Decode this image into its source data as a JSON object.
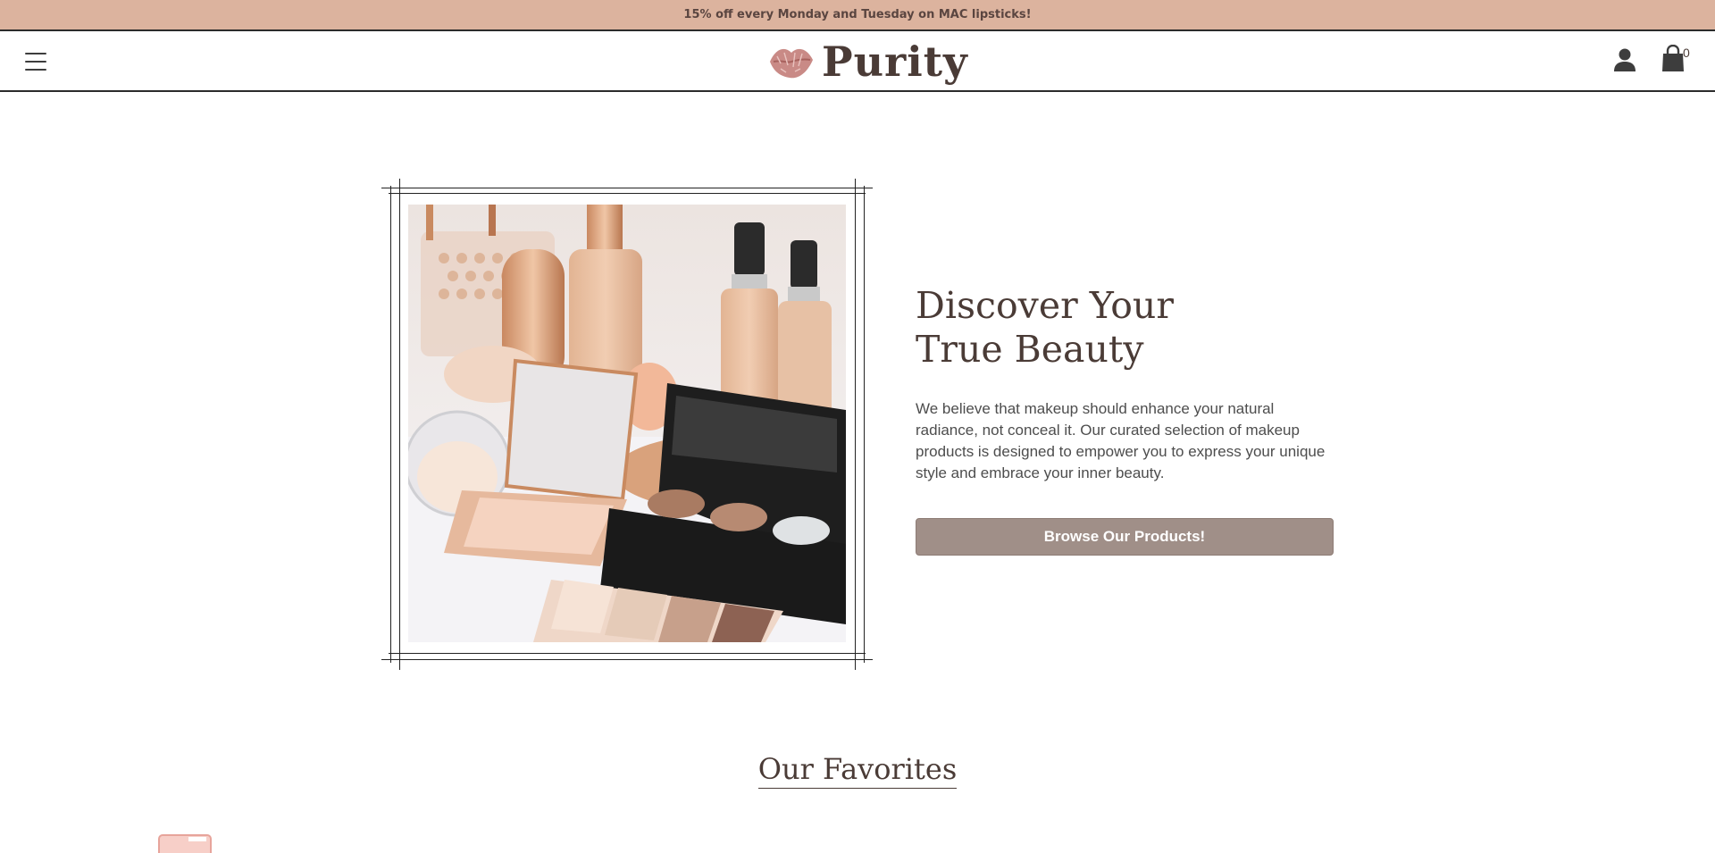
{
  "promo": {
    "text": "15% off every Monday and Tuesday on MAC lipsticks!"
  },
  "header": {
    "logo_text": "Purity",
    "cart_count": "0",
    "icons": {
      "menu": "hamburger-icon",
      "account": "user-icon",
      "cart": "shopping-bag-icon",
      "logo": "lips-icon"
    }
  },
  "hero": {
    "title": "Discover Your True Beauty",
    "description": "We believe that makeup should enhance your natural radiance, not conceal it. Our curated selection of makeup products is designed to empower you to express your unique style and embrace your inner beauty.",
    "button_label": "Browse Our Products!"
  },
  "favorites": {
    "heading": "Our Favorites"
  },
  "colors": {
    "promo_bg": "#dcb39e",
    "text": "#4a3b36",
    "button": "#a08f88",
    "logo_lips": "#c98a86"
  }
}
